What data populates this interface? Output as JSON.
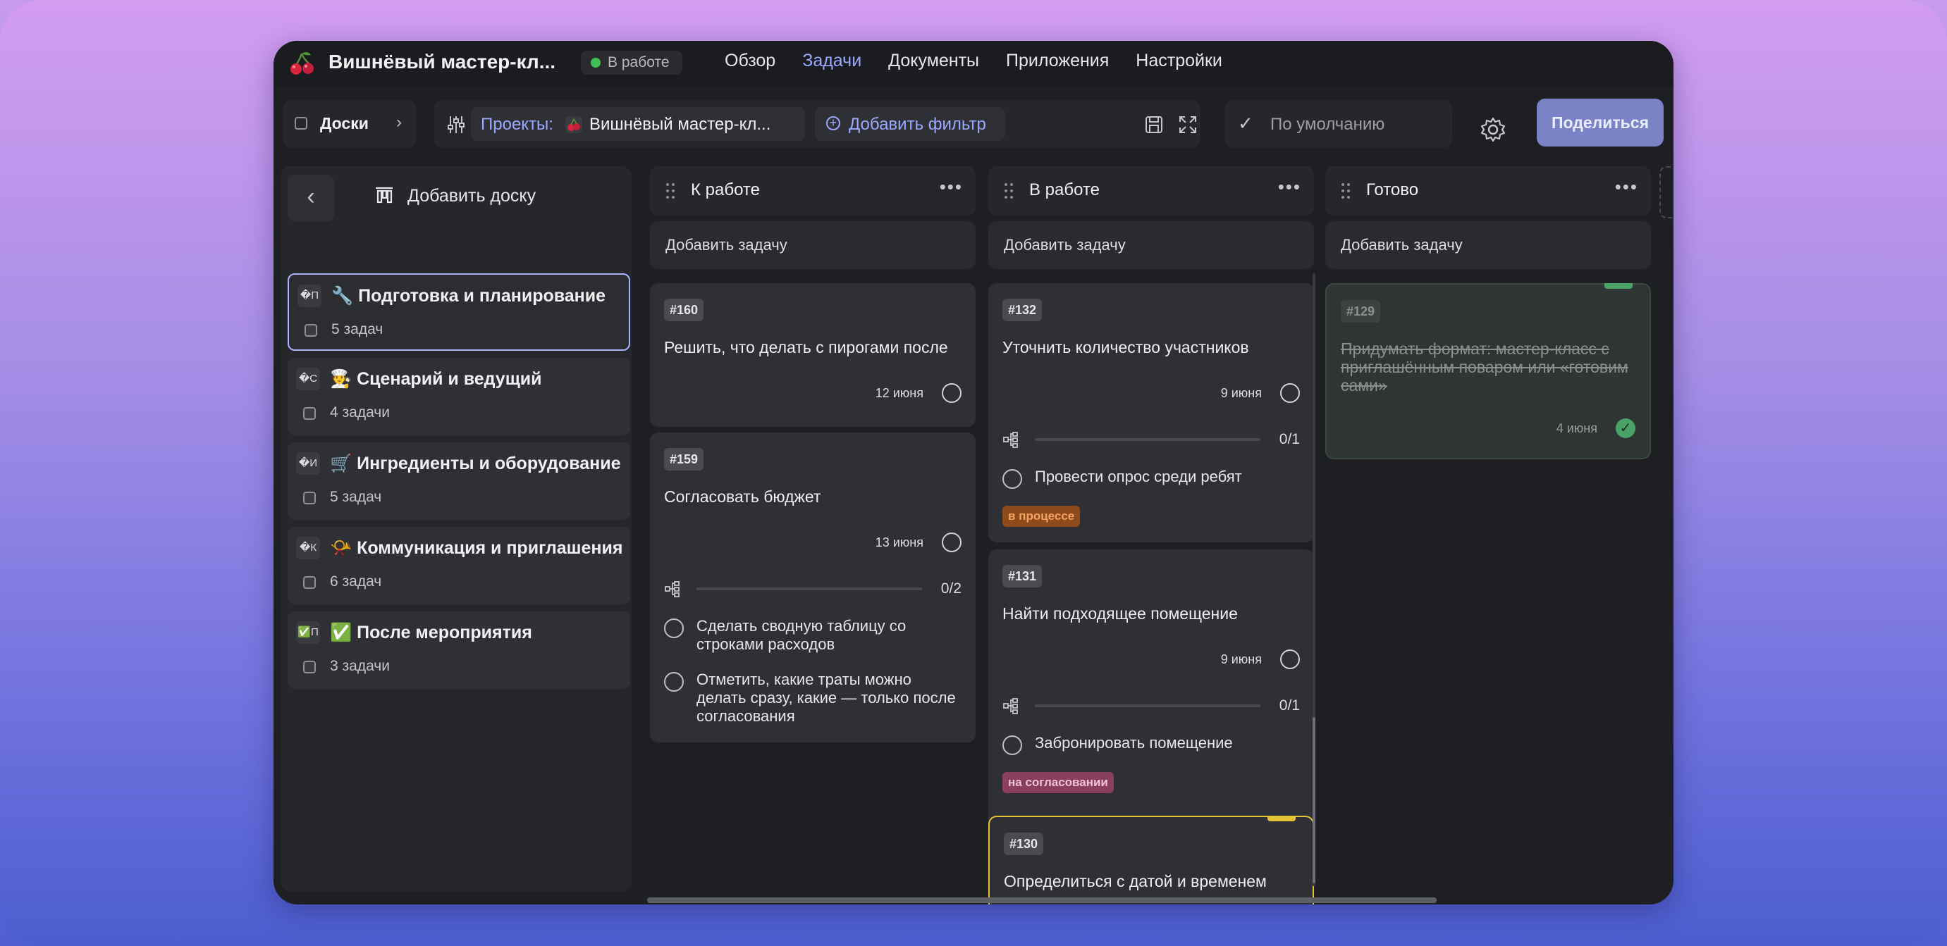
{
  "app": {
    "project_title": "Вишнёвый мастер-кл...",
    "status": "В работе",
    "colors": {
      "accent": "#9aa8ff",
      "status_dot": "#3fbf55",
      "share_button": "#7a83c6"
    }
  },
  "nav": {
    "items": [
      "Обзор",
      "Задачи",
      "Документы",
      "Приложения",
      "Настройки"
    ],
    "active": "Задачи"
  },
  "toolbar": {
    "boards_label": "Доски",
    "filter_key": "Проекты:",
    "filter_value": "Вишнёвый мастер-кл...",
    "add_filter_label": "Добавить фильтр",
    "view_label": "По умолчанию",
    "share_label": "Поделиться"
  },
  "sidebar": {
    "add_board_label": "Добавить доску",
    "boards": [
      {
        "emoji": "🔧",
        "badge": "�П",
        "name": "Подготовка и планирование",
        "count": "5 задач",
        "active": true
      },
      {
        "emoji": "🧑‍🍳",
        "badge": "�С",
        "name": "Сценарий и ведущий",
        "count": "4 задачи",
        "active": false
      },
      {
        "emoji": "🛒",
        "badge": "�И",
        "name": "Ингредиенты и оборудование",
        "count": "5 задач",
        "active": false
      },
      {
        "emoji": "📯",
        "badge": "�К",
        "name": "Коммуникация и приглашения",
        "count": "6 задач",
        "active": false
      },
      {
        "emoji": "✅",
        "badge": "✅П",
        "name": "После мероприятия",
        "count": "3 задачи",
        "active": false
      }
    ]
  },
  "columns": [
    {
      "title": "К работе",
      "add_task_label": "Добавить задачу",
      "cards": [
        {
          "id": "#160",
          "title": "Решить, что делать с пирогами после",
          "date": "12 июня"
        },
        {
          "id": "#159",
          "title": "Согласовать бюджет",
          "date": "13 июня",
          "progress": "0/2",
          "subtasks": [
            "Сделать сводную таблицу со строками расходов",
            "Отметить, какие траты можно делать сразу, какие — только после согласования"
          ]
        }
      ]
    },
    {
      "title": "В работе",
      "add_task_label": "Добавить задачу",
      "cards": [
        {
          "id": "#132",
          "title": "Уточнить количество участников",
          "date": "9 июня",
          "progress": "0/1",
          "subtasks": [
            "Провести опрос среди ребят"
          ],
          "tag": "в процессе"
        },
        {
          "id": "#131",
          "title": "Найти подходящее помещение",
          "date": "9 июня",
          "progress": "0/1",
          "subtasks": [
            "Забронировать помещение"
          ],
          "tag": "на согласовании"
        },
        {
          "id": "#130",
          "title": "Определиться с датой и временем"
        }
      ]
    },
    {
      "title": "Готово",
      "add_task_label": "Добавить задачу",
      "cards": [
        {
          "id": "#129",
          "title": "Придумать формат: мастер-класс с приглашённым поваром или «готовим сами»",
          "date": "4 июня",
          "done": true
        }
      ]
    }
  ]
}
